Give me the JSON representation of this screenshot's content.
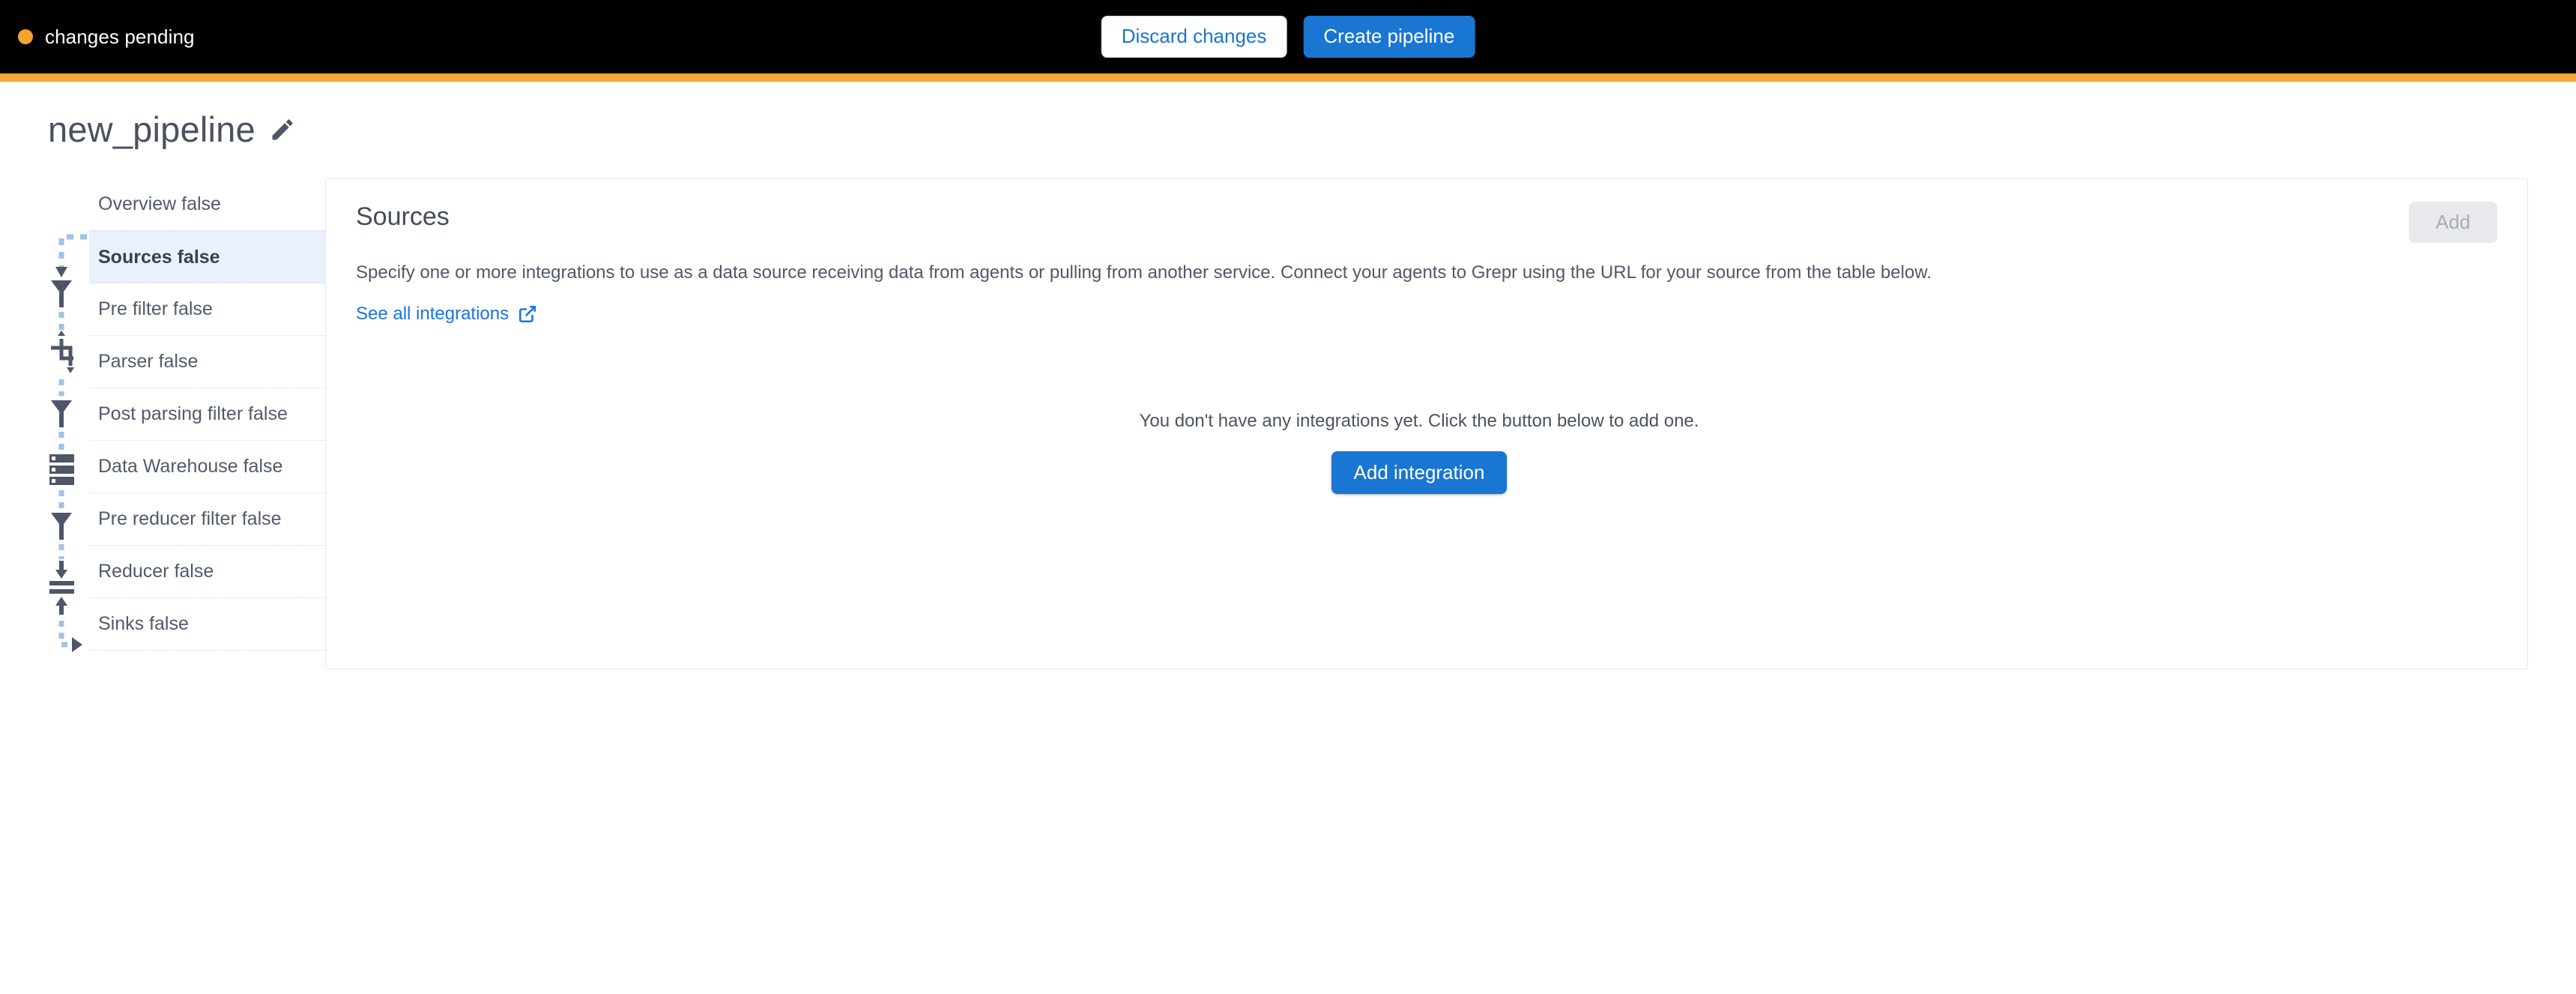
{
  "topbar": {
    "status_text": "changes pending",
    "status_dot_color": "#f5a32a",
    "discard_label": "Discard changes",
    "create_label": "Create pipeline",
    "stripe_color": "#f9a53b",
    "background_color": "#000000"
  },
  "header": {
    "title": "new_pipeline",
    "edit_icon": "pencil-icon"
  },
  "sidebar": {
    "items": [
      {
        "label": "Overview false",
        "icon": "none",
        "active": false
      },
      {
        "label": "Sources false",
        "icon": "source-branch-icon",
        "active": true
      },
      {
        "label": "Pre filter false",
        "icon": "filter-funnel-icon",
        "active": false
      },
      {
        "label": "Parser false",
        "icon": "parser-transform-icon",
        "active": false
      },
      {
        "label": "Post parsing filter false",
        "icon": "filter-funnel-icon",
        "active": false
      },
      {
        "label": "Data Warehouse false",
        "icon": "database-server-icon",
        "active": false
      },
      {
        "label": "Pre reducer filter false",
        "icon": "filter-funnel-icon",
        "active": false
      },
      {
        "label": "Reducer false",
        "icon": "reducer-compress-icon",
        "active": false
      },
      {
        "label": "Sinks false",
        "icon": "sink-arrow-icon",
        "active": false
      }
    ],
    "active_background": "#e9f2fc",
    "connector_color": "#9dc3e6",
    "icon_color": "#4e5668"
  },
  "main": {
    "panel_title": "Sources",
    "add_button_label": "Add",
    "add_button_enabled": false,
    "description": "Specify one or more integrations to use as a data source receiving data from agents or pulling from another service. Connect your agents to Grepr using the URL for your source from the table below.",
    "see_all_link_label": "See all integrations",
    "see_all_link_icon": "external-link-icon",
    "empty_state_text": "You don't have any integrations yet. Click the button below to add one.",
    "empty_state_button_label": "Add integration",
    "primary_color": "#1976d2",
    "link_color": "#1a73e8"
  }
}
